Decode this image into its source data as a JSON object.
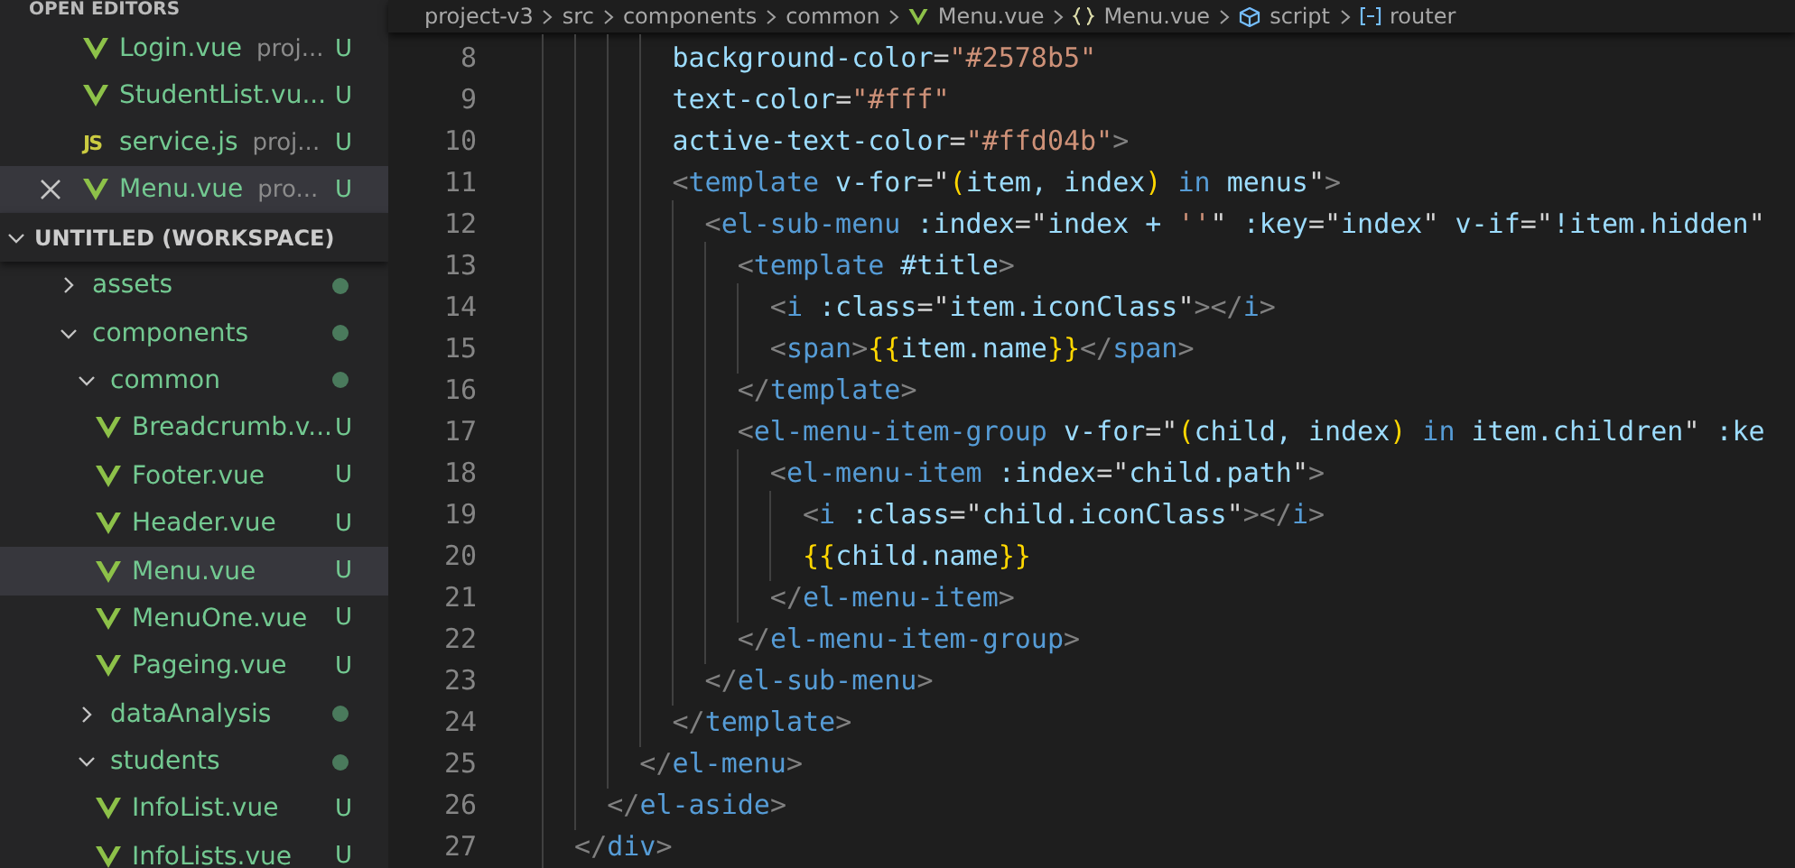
{
  "sidebar": {
    "open_editors": {
      "title": "OPEN EDITORS",
      "items": [
        {
          "kind": "vue",
          "name": "Login.vue",
          "description": "proj...",
          "status": "U",
          "selected": false
        },
        {
          "kind": "vue",
          "name": "StudentList.vu...",
          "status": "U",
          "selected": false
        },
        {
          "kind": "js",
          "badge": "JS",
          "name": "service.js",
          "description": "proj...",
          "status": "U",
          "selected": false
        },
        {
          "kind": "vue",
          "name": "Menu.vue",
          "description": "pro...",
          "status": "U",
          "selected": true
        }
      ]
    },
    "workspace": {
      "title": "UNTITLED (WORKSPACE)",
      "expanded": true,
      "children": [
        {
          "kind": "folder",
          "name": "assets",
          "expanded": false,
          "selected": false
        },
        {
          "kind": "folder",
          "name": "components",
          "expanded": true,
          "selected": false,
          "children": [
            {
              "kind": "folder",
              "name": "common",
              "expanded": true,
              "selected": false,
              "children": [
                {
                  "kind": "vue",
                  "name": "Breadcrumb.v...",
                  "status": "U",
                  "selected": false
                },
                {
                  "kind": "vue",
                  "name": "Footer.vue",
                  "status": "U",
                  "selected": false
                },
                {
                  "kind": "vue",
                  "name": "Header.vue",
                  "status": "U",
                  "selected": false
                },
                {
                  "kind": "vue",
                  "name": "Menu.vue",
                  "status": "U",
                  "selected": true
                },
                {
                  "kind": "vue",
                  "name": "MenuOne.vue",
                  "status": "U",
                  "selected": false
                },
                {
                  "kind": "vue",
                  "name": "Pageing.vue",
                  "status": "U",
                  "selected": false
                }
              ]
            },
            {
              "kind": "folder",
              "name": "dataAnalysis",
              "expanded": false,
              "selected": false
            },
            {
              "kind": "folder",
              "name": "students",
              "expanded": true,
              "selected": false,
              "children": [
                {
                  "kind": "vue",
                  "name": "InfoList.vue",
                  "status": "U",
                  "selected": false
                },
                {
                  "kind": "vue",
                  "name": "InfoLists.vue",
                  "status": "U",
                  "selected": false
                }
              ]
            }
          ]
        }
      ]
    }
  },
  "breadcrumb": [
    {
      "text": "project-v3"
    },
    {
      "text": "src"
    },
    {
      "text": "components"
    },
    {
      "text": "common"
    },
    {
      "kind": "vue",
      "text": "Menu.vue"
    },
    {
      "kind": "braces",
      "text": "Menu.vue"
    },
    {
      "kind": "cube",
      "text": "script"
    },
    {
      "kind": "field",
      "text": "router"
    }
  ],
  "editor": {
    "lines": [
      {
        "number": "8",
        "tokens": [
          {
            "kind": "attr",
            "text": "        background-color"
          },
          {
            "kind": "plain",
            "text": "="
          },
          {
            "kind": "str",
            "text": "\"#2578b5\""
          }
        ]
      },
      {
        "number": "9",
        "tokens": [
          {
            "kind": "attr",
            "text": "        text-color"
          },
          {
            "kind": "plain",
            "text": "="
          },
          {
            "kind": "str",
            "text": "\"#fff\""
          }
        ]
      },
      {
        "number": "10",
        "tokens": [
          {
            "kind": "attr",
            "text": "        active-text-color"
          },
          {
            "kind": "plain",
            "text": "="
          },
          {
            "kind": "str",
            "text": "\"#ffd04b\""
          },
          {
            "kind": "punct",
            "text": ">"
          }
        ]
      },
      {
        "number": "11",
        "tokens": [
          {
            "kind": "punct",
            "text": "        <"
          },
          {
            "kind": "tag",
            "text": "template"
          },
          {
            "kind": "attr",
            "text": " v-for"
          },
          {
            "kind": "plain",
            "text": "=\""
          },
          {
            "kind": "brace",
            "text": "("
          },
          {
            "kind": "attr",
            "text": "item, index"
          },
          {
            "kind": "brace",
            "text": ")"
          },
          {
            "kind": "tag",
            "text": " in "
          },
          {
            "kind": "attr",
            "text": "menus"
          },
          {
            "kind": "plain",
            "text": "\""
          },
          {
            "kind": "punct",
            "text": ">"
          }
        ]
      },
      {
        "number": "12",
        "tokens": [
          {
            "kind": "punct",
            "text": "          <"
          },
          {
            "kind": "tag",
            "text": "el-sub-menu"
          },
          {
            "kind": "attr",
            "text": " :index"
          },
          {
            "kind": "plain",
            "text": "=\""
          },
          {
            "kind": "attr",
            "text": "index + "
          },
          {
            "kind": "str",
            "text": "''"
          },
          {
            "kind": "plain",
            "text": "\""
          },
          {
            "kind": "attr",
            "text": " :key"
          },
          {
            "kind": "plain",
            "text": "=\""
          },
          {
            "kind": "attr",
            "text": "index"
          },
          {
            "kind": "plain",
            "text": "\""
          },
          {
            "kind": "attr",
            "text": " v-if"
          },
          {
            "kind": "plain",
            "text": "=\""
          },
          {
            "kind": "attr",
            "text": "!item.hidden"
          },
          {
            "kind": "plain",
            "text": "\""
          }
        ]
      },
      {
        "number": "13",
        "tokens": [
          {
            "kind": "punct",
            "text": "            <"
          },
          {
            "kind": "tag",
            "text": "template"
          },
          {
            "kind": "attr",
            "text": " #title"
          },
          {
            "kind": "punct",
            "text": ">"
          }
        ]
      },
      {
        "number": "14",
        "tokens": [
          {
            "kind": "punct",
            "text": "              <"
          },
          {
            "kind": "tag",
            "text": "i"
          },
          {
            "kind": "attr",
            "text": " :class"
          },
          {
            "kind": "plain",
            "text": "=\""
          },
          {
            "kind": "attr",
            "text": "item.iconClass"
          },
          {
            "kind": "plain",
            "text": "\""
          },
          {
            "kind": "punct",
            "text": "></"
          },
          {
            "kind": "tag",
            "text": "i"
          },
          {
            "kind": "punct",
            "text": ">"
          }
        ]
      },
      {
        "number": "15",
        "tokens": [
          {
            "kind": "punct",
            "text": "              <"
          },
          {
            "kind": "tag",
            "text": "span"
          },
          {
            "kind": "punct",
            "text": ">"
          },
          {
            "kind": "brace",
            "text": "{{"
          },
          {
            "kind": "attr",
            "text": "item.name"
          },
          {
            "kind": "brace",
            "text": "}}"
          },
          {
            "kind": "punct",
            "text": "</"
          },
          {
            "kind": "tag",
            "text": "span"
          },
          {
            "kind": "punct",
            "text": ">"
          }
        ]
      },
      {
        "number": "16",
        "tokens": [
          {
            "kind": "punct",
            "text": "            </"
          },
          {
            "kind": "tag",
            "text": "template"
          },
          {
            "kind": "punct",
            "text": ">"
          }
        ]
      },
      {
        "number": "17",
        "tokens": [
          {
            "kind": "punct",
            "text": "            <"
          },
          {
            "kind": "tag",
            "text": "el-menu-item-group"
          },
          {
            "kind": "attr",
            "text": " v-for"
          },
          {
            "kind": "plain",
            "text": "=\""
          },
          {
            "kind": "brace",
            "text": "("
          },
          {
            "kind": "attr",
            "text": "child, index"
          },
          {
            "kind": "brace",
            "text": ")"
          },
          {
            "kind": "tag",
            "text": " in "
          },
          {
            "kind": "attr",
            "text": "item.children"
          },
          {
            "kind": "plain",
            "text": "\""
          },
          {
            "kind": "attr",
            "text": " :ke"
          }
        ]
      },
      {
        "number": "18",
        "tokens": [
          {
            "kind": "punct",
            "text": "              <"
          },
          {
            "kind": "tag",
            "text": "el-menu-item"
          },
          {
            "kind": "attr",
            "text": " :index"
          },
          {
            "kind": "plain",
            "text": "=\""
          },
          {
            "kind": "attr",
            "text": "child.path"
          },
          {
            "kind": "plain",
            "text": "\""
          },
          {
            "kind": "punct",
            "text": ">"
          }
        ]
      },
      {
        "number": "19",
        "tokens": [
          {
            "kind": "punct",
            "text": "                <"
          },
          {
            "kind": "tag",
            "text": "i"
          },
          {
            "kind": "attr",
            "text": " :class"
          },
          {
            "kind": "plain",
            "text": "=\""
          },
          {
            "kind": "attr",
            "text": "child.iconClass"
          },
          {
            "kind": "plain",
            "text": "\""
          },
          {
            "kind": "punct",
            "text": "></"
          },
          {
            "kind": "tag",
            "text": "i"
          },
          {
            "kind": "punct",
            "text": ">"
          }
        ]
      },
      {
        "number": "20",
        "tokens": [
          {
            "kind": "brace",
            "text": "                {{"
          },
          {
            "kind": "attr",
            "text": "child.name"
          },
          {
            "kind": "brace",
            "text": "}}"
          }
        ]
      },
      {
        "number": "21",
        "tokens": [
          {
            "kind": "punct",
            "text": "              </"
          },
          {
            "kind": "tag",
            "text": "el-menu-item"
          },
          {
            "kind": "punct",
            "text": ">"
          }
        ]
      },
      {
        "number": "22",
        "tokens": [
          {
            "kind": "punct",
            "text": "            </"
          },
          {
            "kind": "tag",
            "text": "el-menu-item-group"
          },
          {
            "kind": "punct",
            "text": ">"
          }
        ]
      },
      {
        "number": "23",
        "tokens": [
          {
            "kind": "punct",
            "text": "          </"
          },
          {
            "kind": "tag",
            "text": "el-sub-menu"
          },
          {
            "kind": "punct",
            "text": ">"
          }
        ]
      },
      {
        "number": "24",
        "tokens": [
          {
            "kind": "punct",
            "text": "        </"
          },
          {
            "kind": "tag",
            "text": "template"
          },
          {
            "kind": "punct",
            "text": ">"
          }
        ]
      },
      {
        "number": "25",
        "tokens": [
          {
            "kind": "punct",
            "text": "      </"
          },
          {
            "kind": "tag",
            "text": "el-menu"
          },
          {
            "kind": "punct",
            "text": ">"
          }
        ]
      },
      {
        "number": "26",
        "tokens": [
          {
            "kind": "punct",
            "text": "    </"
          },
          {
            "kind": "tag",
            "text": "el-aside"
          },
          {
            "kind": "punct",
            "text": ">"
          }
        ]
      },
      {
        "number": "27",
        "tokens": [
          {
            "kind": "punct",
            "text": "  </"
          },
          {
            "kind": "tag",
            "text": "div"
          },
          {
            "kind": "punct",
            "text": ">"
          }
        ]
      }
    ]
  }
}
